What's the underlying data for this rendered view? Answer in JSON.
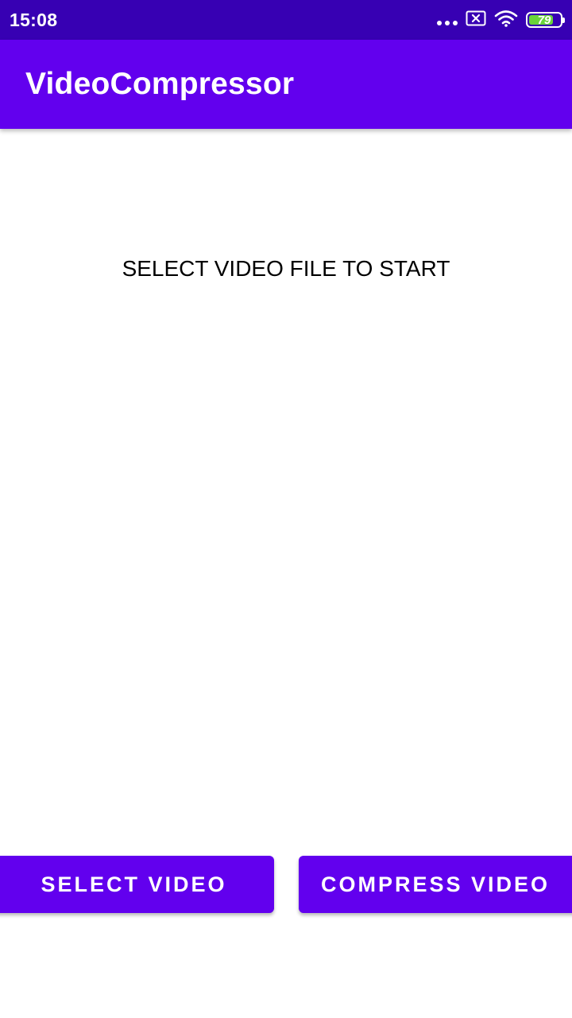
{
  "status_bar": {
    "time": "15:08",
    "icons": [
      "more-dots-icon",
      "notification-x-icon",
      "wifi-icon",
      "battery-icon"
    ],
    "battery_level": "79",
    "battery_fraction": 0.79,
    "battery_color": "#6ad43a"
  },
  "app_bar": {
    "title": "VideoCompressor"
  },
  "main": {
    "status_message": "SELECT VIDEO FILE TO START"
  },
  "buttons": {
    "select_video": "SELECT VIDEO",
    "compress_video": "COMPRESS VIDEO"
  },
  "colors": {
    "status_bar": "#3700b3",
    "primary": "#6200ee",
    "background": "#ffffff",
    "text": "#000000"
  }
}
